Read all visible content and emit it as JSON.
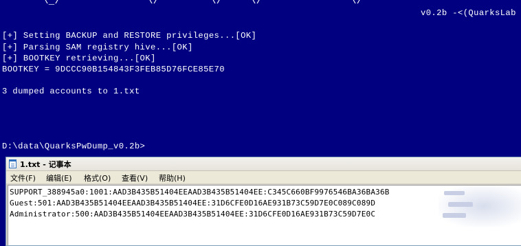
{
  "console": {
    "ascii_art": [
      {
        "text": "\\_/"
      },
      {
        "text": "\\/"
      },
      {
        "text": "\\/"
      },
      {
        "text": "\\/"
      },
      {
        "text": "\\/"
      }
    ],
    "version": "v0.2b -<(QuarksLab",
    "lines": [
      "[+] Setting BACKUP and RESTORE privileges...[OK]",
      "[+] Parsing SAM registry hive...[OK]",
      "[+] BOOTKEY retrieving...[OK]",
      "BOOTKEY = 9DCCC90B154843F3FEB85D76FCE85E70",
      "",
      "3 dumped accounts to 1.txt",
      "",
      "",
      "",
      "",
      "",
      "D:\\data\\QuarksPwDump_v0.2b>"
    ]
  },
  "notepad": {
    "title": "1.txt - 记事本",
    "menu": [
      "文件(F)",
      "编辑(E)",
      "格式(O)",
      "查看(V)",
      "帮助(H)"
    ],
    "content": [
      "SUPPORT_388945a0:1001:AAD3B435B51404EEAAD3B435B51404EE:C345C660BF9976546BA36BA36B",
      "Guest:501:AAD3B435B51404EEAAD3B435B51404EE:31D6CFE0D16AE931B73C59D7E0C089C089D",
      "Administrator:500:AAD3B435B51404EEAAD3B435B51404EE:31D6CFE0D16AE931B73C59D7E0C"
    ]
  },
  "colors": {
    "console_bg": "#000080",
    "console_fg": "#ffffff",
    "notepad_bg": "#ffffff"
  }
}
